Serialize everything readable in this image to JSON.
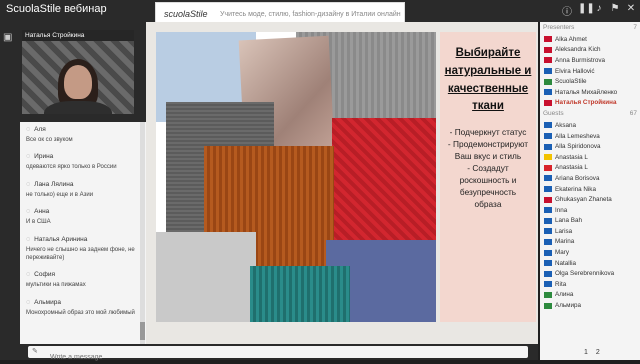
{
  "app": {
    "title": "ScuolaStile вебинар"
  },
  "banner": {
    "brand": "scuolaStile",
    "tagline": "Учитесь моде, стилю, fashion-дизайну в Италии онлайн"
  },
  "toolbar_icons": [
    "info-icon",
    "pause-icon",
    "speaker-icon",
    "flag-icon",
    "close-icon"
  ],
  "video": {
    "speaker": "Наталья Стройкина"
  },
  "chat": {
    "messages": [
      {
        "author": "Аля",
        "text": "Все ок со звуком"
      },
      {
        "author": "Ирина",
        "text": "одеваются ярко только в России"
      },
      {
        "author": "Лана Лялина",
        "text": "не только) еще и в Азии"
      },
      {
        "author": "Анна",
        "text": "И в США"
      },
      {
        "author": "Наталья Аринина",
        "text": "Ничего не слышно на заднем фоне, не переживайте)"
      },
      {
        "author": "София",
        "text": "мультики на пижамах"
      },
      {
        "author": "Альмира",
        "text": "Монохромный образ это мой любимый"
      }
    ],
    "input_placeholder": "Write a message"
  },
  "slide": {
    "title_lines": [
      "Выбирайте",
      "натуральные и",
      "качественные",
      "ткани"
    ],
    "body_lines": [
      "- Подчеркнут статус",
      "- Продемонстрируют",
      "Ваш вкус и  стиль",
      "- Создадут",
      "роскошность и",
      "безупречность",
      "образа"
    ],
    "swatch_colors": [
      "#b9cde3",
      "#c7b2a8",
      "#9b9b9b",
      "#6a6a6a",
      "#d2262f",
      "#b55a1f",
      "#c9c9c9",
      "#5b6aa0",
      "#2a8c8a",
      "#e6e2dc"
    ]
  },
  "presenters": {
    "label": "Presenters",
    "count": "7",
    "items": [
      {
        "name": "Alka Ahmet",
        "flag": "#c8102e"
      },
      {
        "name": "Aleksandra Kich",
        "flag": "#c8102e"
      },
      {
        "name": "Anna Burmistrova",
        "flag": "#c8102e"
      },
      {
        "name": "Elvira Hallović",
        "flag": "#1a5fb4"
      },
      {
        "name": "ScuolaStile",
        "flag": "#2d8a3e"
      },
      {
        "name": "Наталья Михайленко",
        "flag": "#1a5fb4"
      },
      {
        "name": "Наталья Стройкина",
        "flag": "#c8102e",
        "active": true
      }
    ]
  },
  "guests": {
    "label": "Guests",
    "count": "67",
    "items": [
      {
        "name": "Aksana",
        "flag": "#1a5fb4"
      },
      {
        "name": "Alla Lemesheva",
        "flag": "#1a5fb4"
      },
      {
        "name": "Alla Spiridonova",
        "flag": "#1a5fb4"
      },
      {
        "name": "Anastasia L",
        "flag": "#f2c200"
      },
      {
        "name": "Anastasia L",
        "flag": "#d8232a"
      },
      {
        "name": "Ariana Borisova",
        "flag": "#1a5fb4"
      },
      {
        "name": "Ekaterina Nika",
        "flag": "#1a5fb4"
      },
      {
        "name": "Ghukasyan Zhaneta",
        "flag": "#c8102e"
      },
      {
        "name": "Inna",
        "flag": "#1a5fb4"
      },
      {
        "name": "Lana Bah",
        "flag": "#1a5fb4"
      },
      {
        "name": "Larisa",
        "flag": "#1a5fb4"
      },
      {
        "name": "Marina",
        "flag": "#1a5fb4"
      },
      {
        "name": "Mary",
        "flag": "#1a5fb4"
      },
      {
        "name": "Natallia",
        "flag": "#1a5fb4"
      },
      {
        "name": "Olga Serebrennikova",
        "flag": "#1a5fb4"
      },
      {
        "name": "Rita",
        "flag": "#1a5fb4"
      },
      {
        "name": "Алина",
        "flag": "#2d8a3e"
      },
      {
        "name": "Альмира",
        "flag": "#2d8a3e"
      }
    ]
  },
  "pager": {
    "current": "1",
    "next": "2"
  }
}
